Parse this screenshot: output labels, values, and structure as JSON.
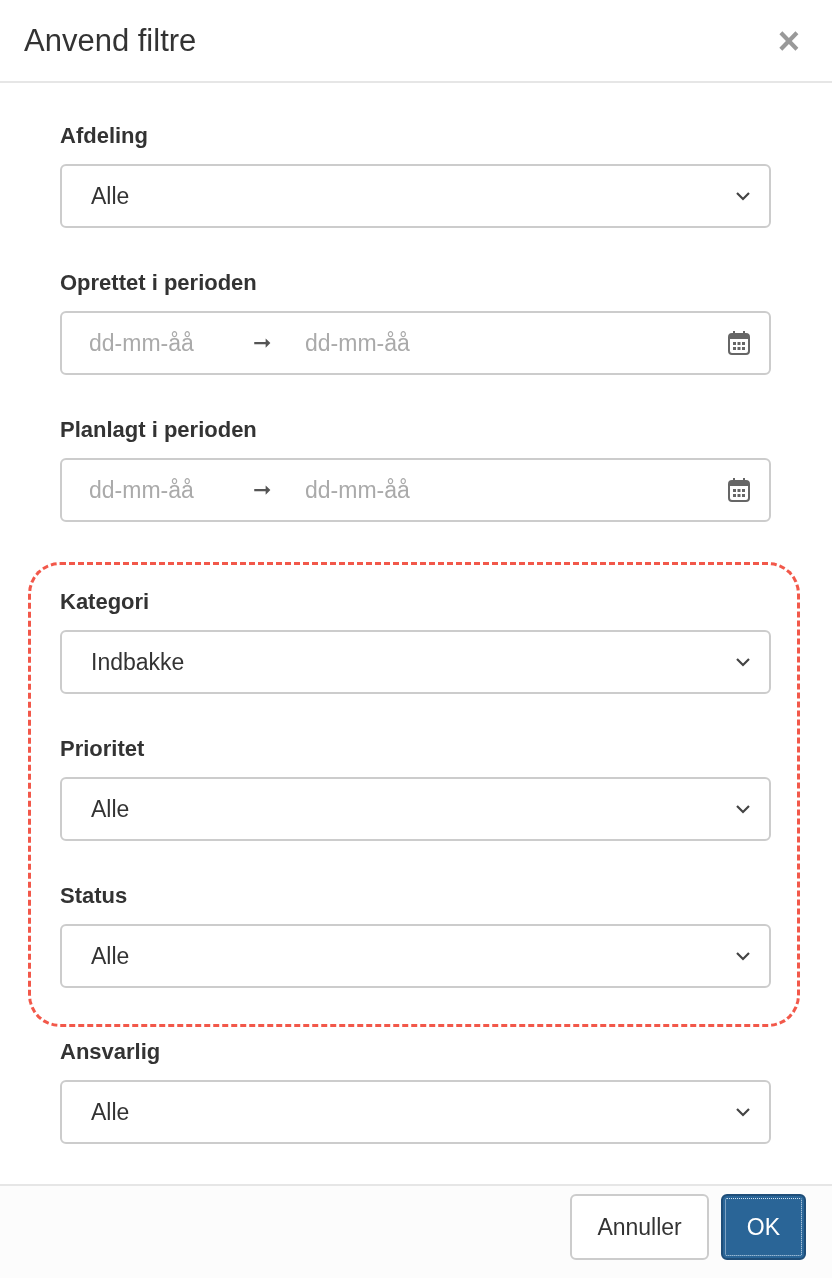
{
  "dialog": {
    "title": "Anvend filtre",
    "close": "×"
  },
  "sections": [
    {
      "highlighted": false,
      "fields": [
        {
          "kind": "select",
          "label": "Afdeling",
          "value": "Alle"
        },
        {
          "kind": "daterange",
          "label": "Oprettet i perioden",
          "from_placeholder": "dd-mm-åå",
          "arrow": "➞",
          "to_placeholder": "dd-mm-åå"
        },
        {
          "kind": "daterange",
          "label": "Planlagt i perioden",
          "from_placeholder": "dd-mm-åå",
          "arrow": "➞",
          "to_placeholder": "dd-mm-åå"
        }
      ]
    },
    {
      "highlighted": true,
      "fields": [
        {
          "kind": "select",
          "label": "Kategori",
          "value": "Indbakke"
        },
        {
          "kind": "select",
          "label": "Prioritet",
          "value": "Alle"
        },
        {
          "kind": "select",
          "label": "Status",
          "value": "Alle"
        }
      ]
    },
    {
      "highlighted": false,
      "fields": [
        {
          "kind": "select",
          "label": "Ansvarlig",
          "value": "Alle"
        }
      ]
    }
  ],
  "buttons": [
    {
      "label": "Annuller",
      "primary": false
    },
    {
      "label": "OK",
      "primary": true
    }
  ]
}
